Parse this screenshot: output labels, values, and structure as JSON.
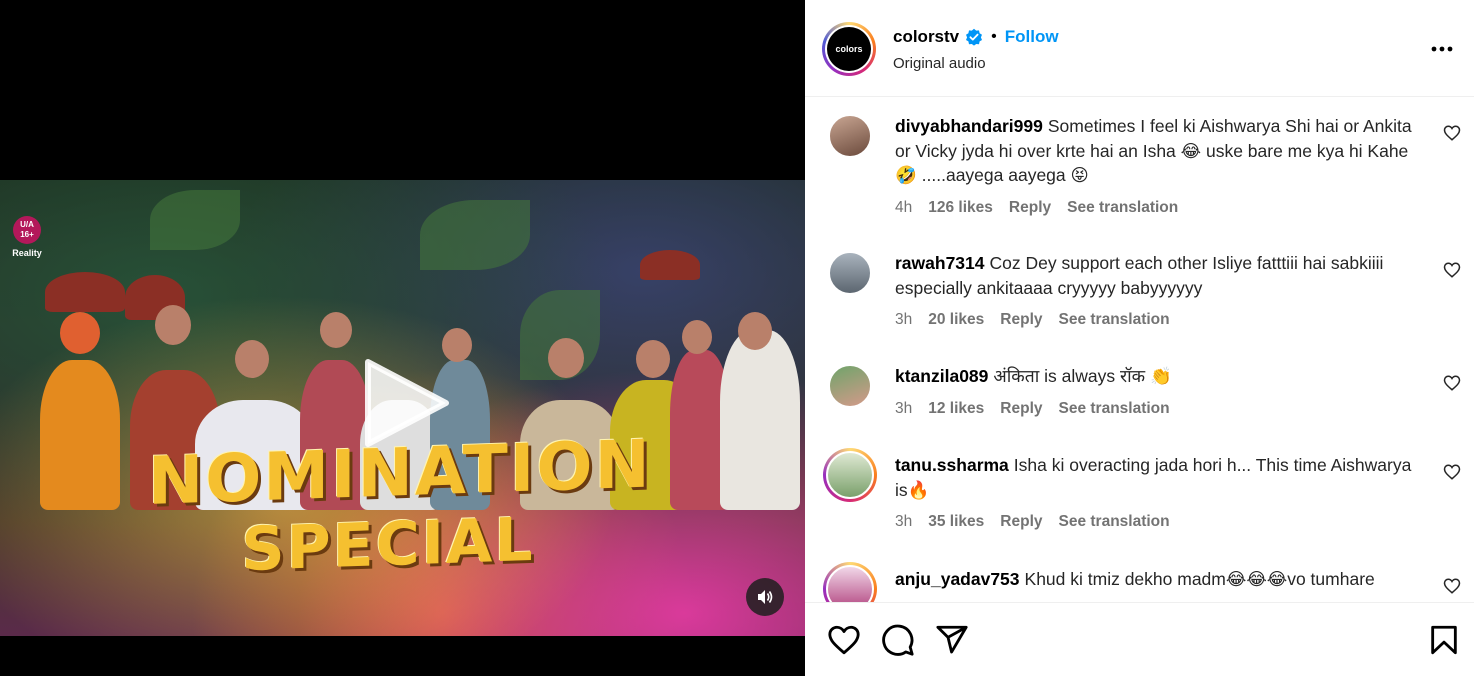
{
  "video": {
    "rating": {
      "line1": "U/A",
      "line2": "16+",
      "label": "Reality"
    },
    "title_line1": "NOMINATION",
    "title_line2": "SPECIAL"
  },
  "header": {
    "username": "colorstv",
    "avatar_text": "colors",
    "separator": "•",
    "follow_label": "Follow",
    "audio": "Original audio"
  },
  "comments": [
    {
      "username": "divyabhandari999",
      "text": "Sometimes I feel ki Aishwarya Shi hai or Ankita or Vicky jyda hi over krte hai an Isha 😂 uske bare me kya hi Kahe 🤣 .....aayega aayega 😝",
      "time": "4h",
      "likes": "126 likes",
      "reply": "Reply",
      "translate": "See translation"
    },
    {
      "username": "rawah7314",
      "text": "Coz Dey support each other Isliye fatttiii hai sabkiiii especially ankitaaaa cryyyyy babyyyyyy",
      "time": "3h",
      "likes": "20 likes",
      "reply": "Reply",
      "translate": "See translation"
    },
    {
      "username": "ktanzila089",
      "text": "अंकिता is always रॉक 👏",
      "time": "3h",
      "likes": "12 likes",
      "reply": "Reply",
      "translate": "See translation"
    },
    {
      "username": "tanu.ssharma",
      "text": "Isha ki overacting jada hori h... This time Aishwarya is🔥",
      "time": "3h",
      "likes": "35 likes",
      "reply": "Reply",
      "translate": "See translation"
    },
    {
      "username": "anju_yadav753",
      "text": "Khud ki tmiz dekho madm😂😂😂vo tumhare"
    }
  ],
  "colors": {
    "follow": "#0095f6",
    "verified": "#0095f6"
  }
}
